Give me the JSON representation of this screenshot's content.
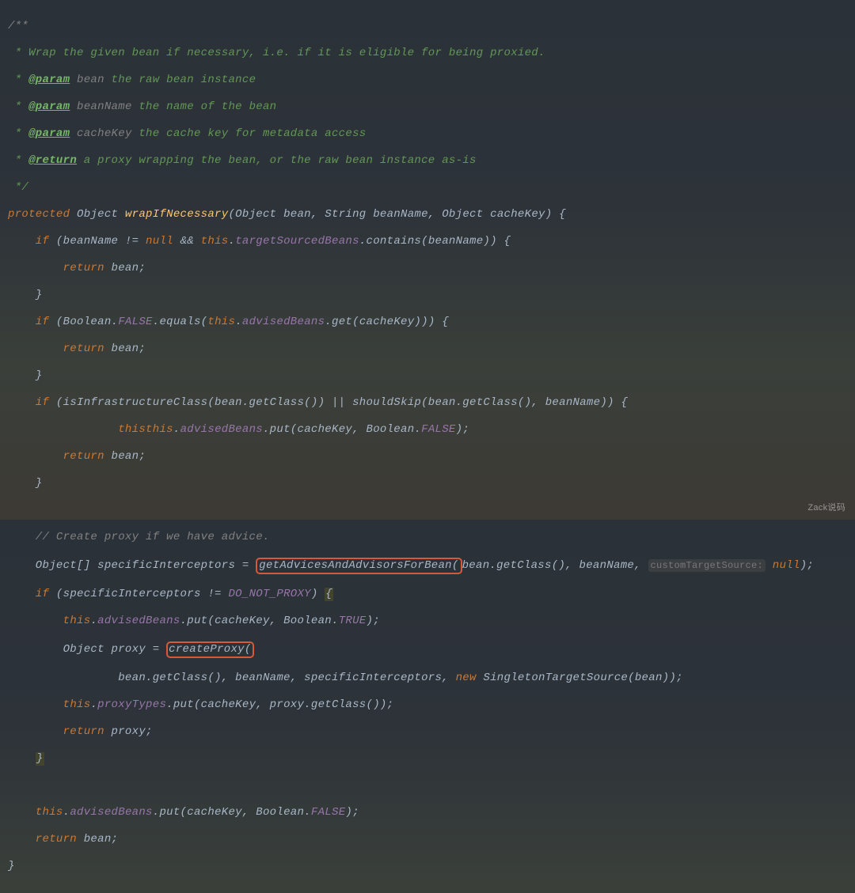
{
  "comment": {
    "start": "/**",
    "l1": " * Wrap the given bean if necessary, i.e. if it is eligible for being proxied.",
    "l2a": " * ",
    "l2tag": "@param",
    "l2name": " bean",
    "l2desc": " the raw bean instance",
    "l3a": " * ",
    "l3tag": "@param",
    "l3name": " beanName",
    "l3desc": " the name of the bean",
    "l4a": " * ",
    "l4tag": "@param",
    "l4name": " cacheKey",
    "l4desc": " the cache key for metadata access",
    "l5a": " * ",
    "l5tag": "@return",
    "l5desc": " a proxy wrapping the bean, or the raw bean instance as-is",
    "end": " */"
  },
  "code": {
    "sig1": "protected ",
    "sigType": "Object ",
    "sigName": "wrapIfNecessary",
    "sigParams": "(Object bean, String beanName, Object cacheKey) {",
    "if1a": "    if ",
    "if1b": "(beanName != ",
    "if1null": "null ",
    "if1c": "&& ",
    "if1this": "this",
    "if1dot": ".",
    "if1field": "targetSourcedBeans",
    "if1call": ".contains(beanName)) {",
    "ret1": "        return ",
    "ret1b": "bean;",
    "cl1": "    }",
    "if2a": "    if ",
    "if2b": "(Boolean.",
    "if2false": "FALSE",
    "if2c": ".equals(",
    "if2this": "this",
    "if2dot": ".",
    "if2field": "advisedBeans",
    "if2call": ".get(cacheKey))) {",
    "ret2": "        return ",
    "ret2b": "bean;",
    "cl2": "    }",
    "if3a": "    if ",
    "if3b": "(isInfrastructureClass(bean.getClass()) || shouldSkip(bean.getClass(), beanName)) {",
    "put1a": "        this",
    "put1dot": ".",
    "put1field": "advisedBeans",
    "put1call": ".put(cacheKey, Boolean.",
    "put1false": "FALSE",
    "put1end": ");",
    "ret3": "        return ",
    "ret3b": "bean;",
    "cl3": "    }",
    "cmt2": "    // Create proxy if we have advice.",
    "si1": "    Object[] specificInterceptors = ",
    "si_hl": "getAdvicesAndAdvisorsForBean(",
    "si2": "bean.getClass(), beanName, ",
    "si_hint": "customTargetSource:",
    "si_null": " null",
    "si_end": ");",
    "if4a": "    if ",
    "if4b": "(specificInterceptors != ",
    "if4const": "DO_NOT_PROXY",
    "if4c": ") ",
    "if4brace": "{",
    "put2a": "        this",
    "put2dot": ".",
    "put2field": "advisedBeans",
    "put2call": ".put(cacheKey, Boolean.",
    "put2true": "TRUE",
    "put2end": ");",
    "proxy1": "        Object proxy = ",
    "proxy_hl": "createProxy(",
    "proxy2": "                bean.getClass(), beanName, specificInterceptors, ",
    "proxy_new": "new ",
    "proxy_ctor": "SingletonTargetSource(bean));",
    "pt1": "        this",
    "ptdot": ".",
    "ptfield": "proxyTypes",
    "ptcall": ".put(cacheKey, proxy.getClass());",
    "retp": "        return ",
    "retpb": "proxy;",
    "cl4": "    ",
    "cl4b": "}",
    "put3a": "    this",
    "put3dot": ".",
    "put3field": "advisedBeans",
    "put3call": ".put(cacheKey, Boolean.",
    "put3false": "FALSE",
    "put3end": ");",
    "retf": "    return ",
    "retfb": "bean;",
    "end": "}"
  },
  "watermark": "Zack说码"
}
